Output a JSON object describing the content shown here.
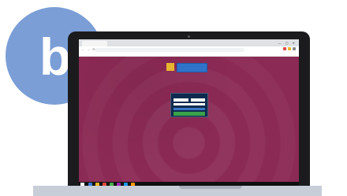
{
  "badge": {
    "letter": "b",
    "color": "#7b9ed6"
  },
  "browser": {
    "tab_title": "",
    "address": "",
    "bookmarks": "",
    "window_controls": "— ▢ ✕",
    "nav_icons": "← → ⟳"
  },
  "page": {
    "background_color": "#8b2a55",
    "popup_label": "",
    "logo_text": "",
    "logo_accent": "",
    "login": {
      "label_1": "",
      "label_2": "",
      "submit_label": ""
    },
    "footer_text": ""
  },
  "taskbar": {
    "tray_text": ""
  },
  "icons": [
    "back-icon",
    "forward-icon",
    "reload-icon",
    "windows-start-icon",
    "taskbar-app-icon"
  ]
}
